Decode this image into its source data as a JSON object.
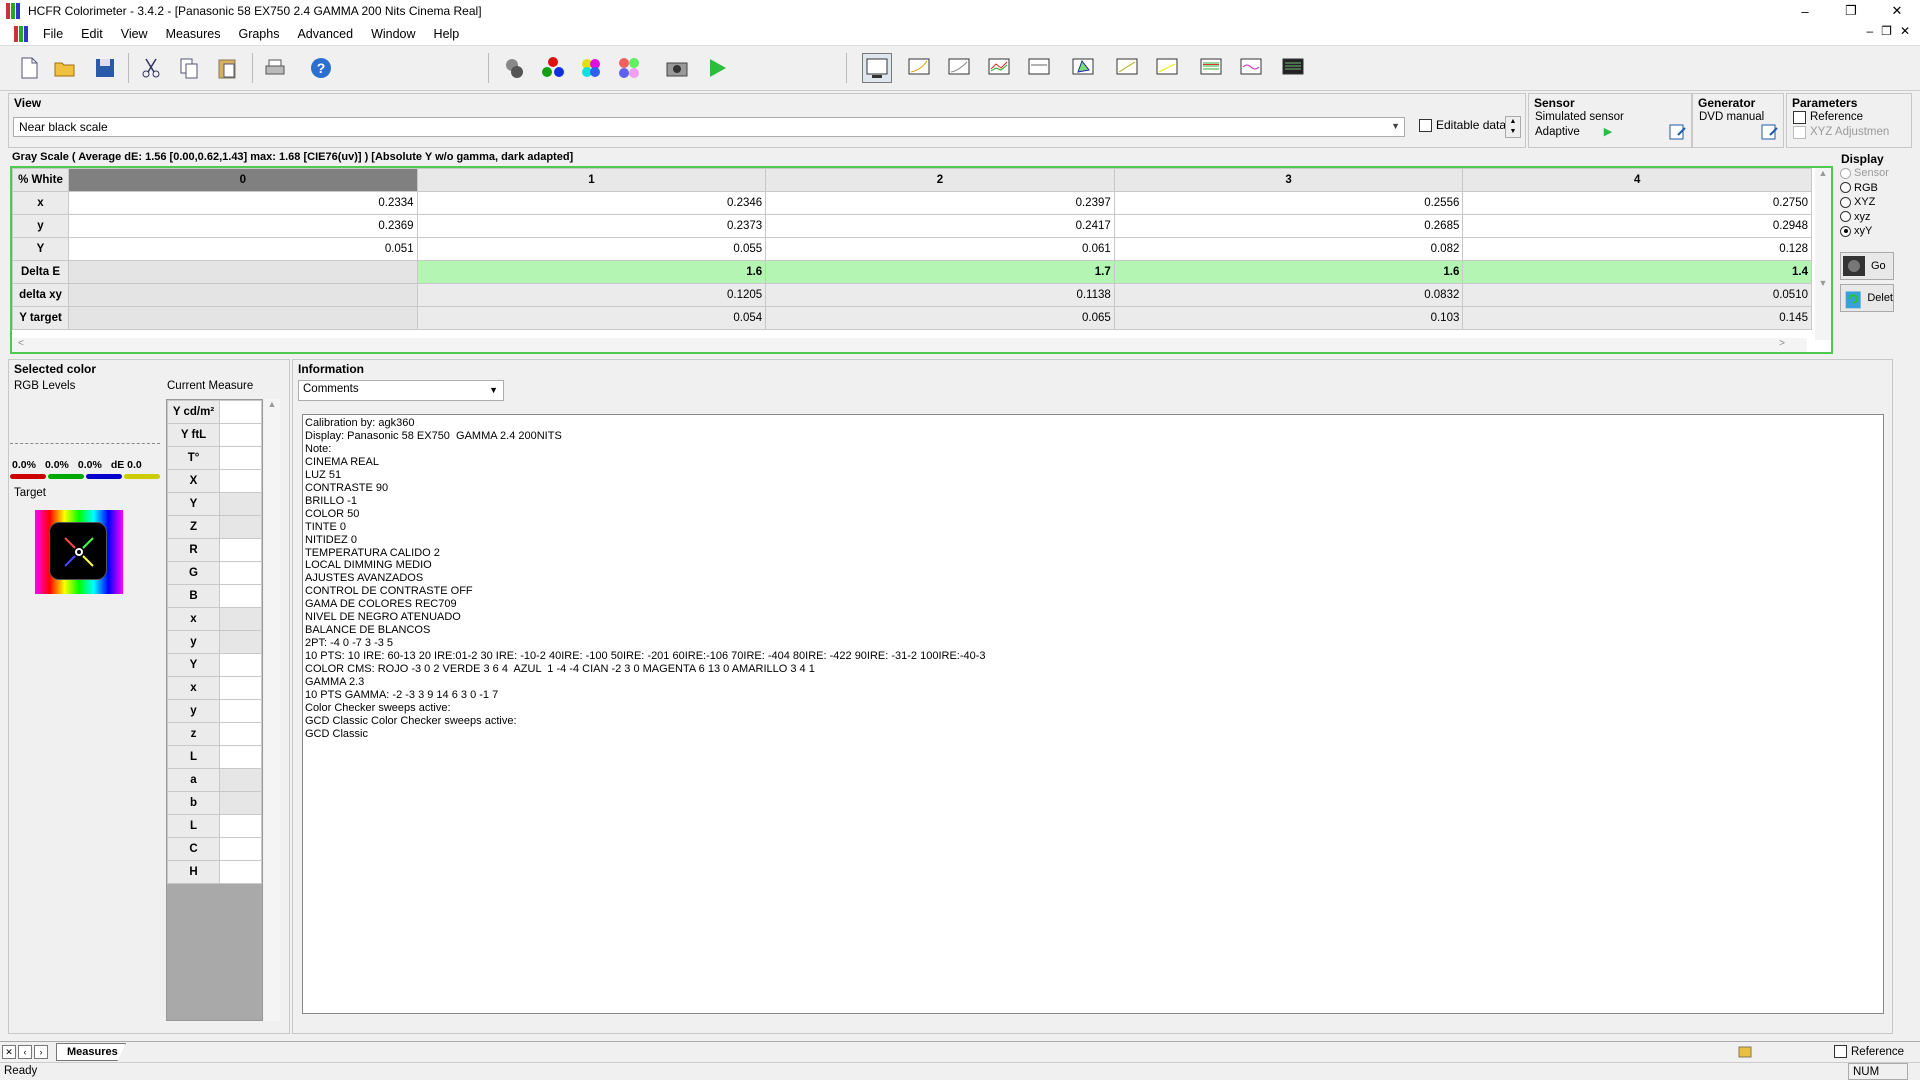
{
  "window": {
    "title": "HCFR Colorimeter - 3.4.2 - [Panasonic 58 EX750 2.4 GAMMA 200 Nits Cinema Real]",
    "min": "–",
    "restore": "❐",
    "close": "✕"
  },
  "menu": [
    "File",
    "Edit",
    "View",
    "Measures",
    "Graphs",
    "Advanced",
    "Window",
    "Help"
  ],
  "view": {
    "header": "View",
    "selected": "Near black scale",
    "editable_label": "Editable data"
  },
  "sensor": {
    "header": "Sensor",
    "name": "Simulated sensor",
    "mode": "Adaptive"
  },
  "generator": {
    "header": "Generator",
    "name": "DVD manual"
  },
  "parameters": {
    "header": "Parameters",
    "reference_label": "Reference",
    "xyz_label": "XYZ Adjustmen"
  },
  "grid": {
    "caption": "Gray Scale ( Average dE: 1.56 [0.00,0.62,1.43] max: 1.68 [CIE76(uv)] ) [Absolute Y w/o gamma, dark adapted]",
    "corner": "% White",
    "columns": [
      "0",
      "1",
      "2",
      "3",
      "4"
    ],
    "rows": [
      {
        "label": "x",
        "values": [
          "0.2334",
          "0.2346",
          "0.2397",
          "0.2556",
          "0.2750"
        ]
      },
      {
        "label": "y",
        "values": [
          "0.2369",
          "0.2373",
          "0.2417",
          "0.2685",
          "0.2948"
        ]
      },
      {
        "label": "Y",
        "values": [
          "0.051",
          "0.055",
          "0.061",
          "0.082",
          "0.128"
        ]
      },
      {
        "label": "Delta E",
        "values": [
          "",
          "1.6",
          "1.7",
          "1.6",
          "1.4"
        ]
      },
      {
        "label": "delta xy",
        "values": [
          "",
          "0.1205",
          "0.1138",
          "0.0832",
          "0.0510"
        ]
      },
      {
        "label": "Y target",
        "values": [
          "",
          "0.054",
          "0.065",
          "0.103",
          "0.145"
        ]
      }
    ]
  },
  "display": {
    "header": "Display",
    "options": [
      "Sensor",
      "RGB",
      "XYZ",
      "xyz",
      "xyY"
    ],
    "selected": "xyY",
    "go_label": "Go",
    "delete_label": "Delet"
  },
  "selected_color": {
    "header": "Selected color",
    "rgb_levels_label": "RGB Levels",
    "current_measure_label": "Current Measure",
    "percent_r": "0.0%",
    "percent_g": "0.0%",
    "percent_b": "0.0%",
    "de_label": "dE 0.0",
    "target_label": "Target",
    "measure_rows": [
      "Y cd/m²",
      "Y ftL",
      "T°",
      "X",
      "Y",
      "Z",
      "R",
      "G",
      "B",
      "x",
      "y",
      "Y",
      "x",
      "y",
      "z",
      "L",
      "a",
      "b",
      "L",
      "C",
      "H"
    ]
  },
  "information": {
    "header": "Information",
    "selected": "Comments",
    "text": "Calibration by: agk360\nDisplay: Panasonic 58 EX750  GAMMA 2.4 200NITS\nNote:\nCINEMA REAL\nLUZ 51\nCONTRASTE 90\nBRILLO -1\nCOLOR 50\nTINTE 0\nNITIDEZ 0\nTEMPERATURA CALIDO 2\nLOCAL DIMMING MEDIO\nAJUSTES AVANZADOS\nCONTROL DE CONTRASTE OFF\nGAMA DE COLORES REC709\nNIVEL DE NEGRO ATENUADO\nBALANCE DE BLANCOS\n2PT: -4 0 -7 3 -3 5\n10 PTS: 10 IRE: 60-13 20 IRE:01-2 30 IRE: -10-2 40IRE: -100 50IRE: -201 60IRE:-106 70IRE: -404 80IRE: -422 90IRE: -31-2 100IRE:-40-3\nCOLOR CMS: ROJO -3 0 2 VERDE 3 6 4  AZUL  1 -4 -4 CIAN -2 3 0 MAGENTA 6 13 0 AMARILLO 3 4 1\nGAMMA 2.3\n10 PTS GAMMA: -2 -3 3 9 14 6 3 0 -1 7\nColor Checker sweeps active:\nGCD Classic Color Checker sweeps active:\nGCD Classic"
  },
  "tabs": {
    "active": "Measures",
    "reference_label": "Reference"
  },
  "status": {
    "text": "Ready",
    "num": "NUM"
  },
  "colors": {
    "grid_border": "#4fc94f",
    "delta_e_bg": "#b4f5b4",
    "selected_col": "#808080"
  }
}
